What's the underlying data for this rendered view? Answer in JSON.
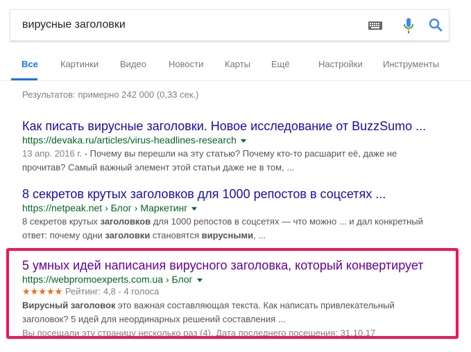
{
  "search": {
    "query": "вирусные заголовки"
  },
  "tabs": [
    {
      "label": "Все"
    },
    {
      "label": "Картинки"
    },
    {
      "label": "Видео"
    },
    {
      "label": "Новости"
    },
    {
      "label": "Карты"
    },
    {
      "label": "Ещё"
    },
    {
      "label": "Настройки"
    },
    {
      "label": "Инструменты"
    }
  ],
  "stats": "Результатов: примерно 242 000 (0,33 сек.)",
  "results": [
    {
      "title": "Как писать вирусные заголовки. Новое исследование от BuzzSumo ...",
      "url": "https://devaka.ru/articles/virus-headlines-research",
      "date": "13 апр. 2016 г.",
      "snippet_line1": " - Почему вы перешли на эту статью? Почему кто-то расшарит её, даже не",
      "snippet_line2": "прочитав? Самый важный элемент этой статьи даже не в том, ..."
    },
    {
      "title": "8 секретов крутых заголовков для 1000 репостов в соцсетях ...",
      "url": "https://netpeak.net › Блог › Маркетинг",
      "snippet_a": "8 секретов крутых ",
      "snippet_b": "заголовков",
      "snippet_c": " для 1000 репостов в соцсетях — что можно ... и дал конкретный",
      "snippet_d": "ответ: почему одни ",
      "snippet_e": "заголовки",
      "snippet_f": " становятся ",
      "snippet_g": "вирусными",
      "snippet_h": ", ..."
    },
    {
      "title": "5 умных идей написания вирусного заголовка, который конвертирует",
      "url": "https://webpromoexperts.com.ua › Блог",
      "stars": "★★★★★",
      "rating_text": " Рейтинг: 4,8 - 4 голоса",
      "snippet_a": "Вирусный заголовок",
      "snippet_b": " это важная составляющая текста. Как написать привлекательный",
      "snippet_c": "заголовок? 5 идей для неординарных решений составления ...",
      "visited_note": "Вы посещали эту страницу несколько раз (4). Дата последнего посещения: 31.10.17"
    }
  ],
  "colors": {
    "link": "#1a0dab",
    "visited": "#660099",
    "url": "#006621",
    "highlight": "#f0145a",
    "active_tab": "#1a73e8",
    "stars": "#e7711b"
  }
}
